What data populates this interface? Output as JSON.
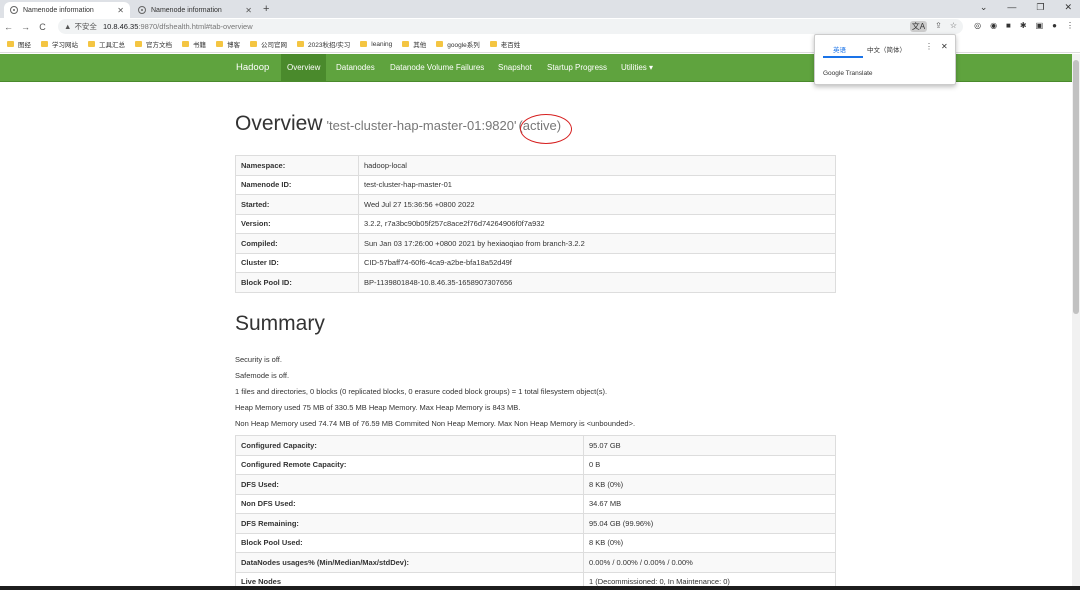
{
  "browser": {
    "tabs": [
      {
        "title": "Namenode information",
        "active": true
      },
      {
        "title": "Namenode information",
        "active": false
      }
    ],
    "new_tab": "+",
    "address": {
      "insecure_label": "不安全",
      "host": "10.8.46.35",
      "path": ":9870/dfshealth.html#tab-overview"
    },
    "bookmarks": [
      "图经",
      "学习网站",
      "工具汇总",
      "官方文档",
      "书籍",
      "博客",
      "公司官网",
      "2023秋招/实习",
      "leaning",
      "其他",
      "google系列",
      "老百姓"
    ],
    "translate_popup": {
      "lang_source": "英语",
      "lang_target": "中文（简体）",
      "brand": "Google Translate"
    }
  },
  "navbar": {
    "brand": "Hadoop",
    "items": [
      "Overview",
      "Datanodes",
      "Datanode Volume Failures",
      "Snapshot",
      "Startup Progress",
      "Utilities ▾"
    ]
  },
  "overview": {
    "title": "Overview",
    "host": "'test-cluster-hap-master-01:9820'",
    "state": "(active)",
    "rows": [
      {
        "key": "Namespace:",
        "value": "hadoop-local"
      },
      {
        "key": "Namenode ID:",
        "value": "test-cluster-hap-master-01"
      },
      {
        "key": "Started:",
        "value": "Wed Jul 27 15:36:56 +0800 2022"
      },
      {
        "key": "Version:",
        "value": "3.2.2, r7a3bc90b05f257c8ace2f76d74264906f0f7a932"
      },
      {
        "key": "Compiled:",
        "value": "Sun Jan 03 17:26:00 +0800 2021 by hexiaoqiao from branch-3.2.2"
      },
      {
        "key": "Cluster ID:",
        "value": "CID-57baff74-60f6-4ca9-a2be-bfa18a52d49f"
      },
      {
        "key": "Block Pool ID:",
        "value": "BP-1139801848-10.8.46.35-1658907307656"
      }
    ]
  },
  "summary": {
    "title": "Summary",
    "lines": [
      "Security is off.",
      "Safemode is off.",
      "1 files and directories, 0 blocks (0 replicated blocks, 0 erasure coded block groups) = 1 total filesystem object(s).",
      "Heap Memory used 75 MB of 330.5 MB Heap Memory. Max Heap Memory is 843 MB.",
      "Non Heap Memory used 74.74 MB of 76.59 MB Commited Non Heap Memory. Max Non Heap Memory is <unbounded>."
    ],
    "rows": [
      {
        "key": "Configured Capacity:",
        "value": "95.07 GB"
      },
      {
        "key": "Configured Remote Capacity:",
        "value": "0 B"
      },
      {
        "key": "DFS Used:",
        "value": "8 KB (0%)"
      },
      {
        "key": "Non DFS Used:",
        "value": "34.67 MB"
      },
      {
        "key": "DFS Remaining:",
        "value": "95.04 GB (99.96%)"
      },
      {
        "key": "Block Pool Used:",
        "value": "8 KB (0%)"
      },
      {
        "key": "DataNodes usages% (Min/Median/Max/stdDev):",
        "value": "0.00% / 0.00% / 0.00% / 0.00%"
      },
      {
        "key": "Live Nodes",
        "value": "1 (Decommissioned: 0, In Maintenance: 0)"
      }
    ]
  }
}
